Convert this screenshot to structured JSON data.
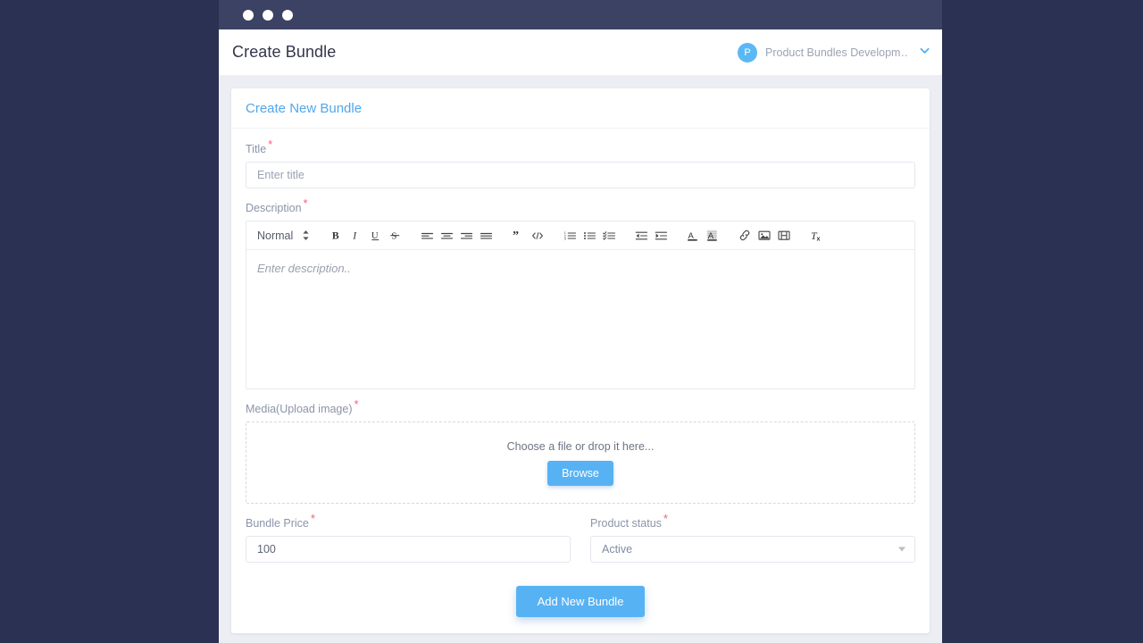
{
  "window": {
    "traffic_lights": [
      "close",
      "minimize",
      "maximize"
    ]
  },
  "appbar": {
    "title": "Create Bundle",
    "account": {
      "avatar_initial": "P",
      "name": "Product Bundles Developm…",
      "caret_icon": "chevron-down-icon"
    }
  },
  "card": {
    "title": "Create New Bundle"
  },
  "form": {
    "title_field": {
      "label": "Title",
      "required_marker": "*",
      "placeholder": "Enter title",
      "value": ""
    },
    "description_field": {
      "label": "Description",
      "required_marker": "*",
      "placeholder": "Enter description..",
      "value": ""
    },
    "editor_toolbar": {
      "format_select": {
        "value": "Normal",
        "stepper_icon": "up-down-arrows-icon"
      },
      "buttons": [
        {
          "name": "bold-icon",
          "label": "B"
        },
        {
          "name": "italic-icon",
          "label": "I"
        },
        {
          "name": "underline-icon",
          "label": "U"
        },
        {
          "name": "strikethrough-icon",
          "label": "S"
        },
        {
          "name": "align-left-icon",
          "label": "Align left"
        },
        {
          "name": "align-center-icon",
          "label": "Align center"
        },
        {
          "name": "align-right-icon",
          "label": "Align right"
        },
        {
          "name": "align-justify-icon",
          "label": "Justify"
        },
        {
          "name": "blockquote-icon",
          "label": "Blockquote"
        },
        {
          "name": "code-block-icon",
          "label": "Code"
        },
        {
          "name": "ordered-list-icon",
          "label": "Numbered list"
        },
        {
          "name": "bullet-list-icon",
          "label": "Bulleted list"
        },
        {
          "name": "checklist-icon",
          "label": "Check list"
        },
        {
          "name": "outdent-icon",
          "label": "Decrease indent"
        },
        {
          "name": "indent-icon",
          "label": "Increase indent"
        },
        {
          "name": "text-color-icon",
          "label": "Text color"
        },
        {
          "name": "background-color-icon",
          "label": "Background color"
        },
        {
          "name": "link-icon",
          "label": "Insert link"
        },
        {
          "name": "image-icon",
          "label": "Insert image"
        },
        {
          "name": "video-icon",
          "label": "Insert video"
        },
        {
          "name": "clear-formatting-icon",
          "label": "Clear formatting"
        }
      ]
    },
    "media_field": {
      "label": "Media(Upload image)",
      "required_marker": "*",
      "dropzone_text": "Choose a file or drop it here...",
      "browse_label": "Browse"
    },
    "price_field": {
      "label": "Bundle Price",
      "required_marker": "*",
      "value": "100"
    },
    "status_field": {
      "label": "Product status",
      "required_marker": "*",
      "value": "Active",
      "arrow_icon": "caret-down-icon"
    },
    "submit_label": "Add New Bundle"
  },
  "colors": {
    "page_background": "#2a3152",
    "titlebar": "#3b4264",
    "content_background": "#eceef3",
    "accent_blue": "#57b2f3",
    "card_title_blue": "#50a7ec",
    "required_red": "#f4607a",
    "label_gray": "#8b94a8"
  }
}
